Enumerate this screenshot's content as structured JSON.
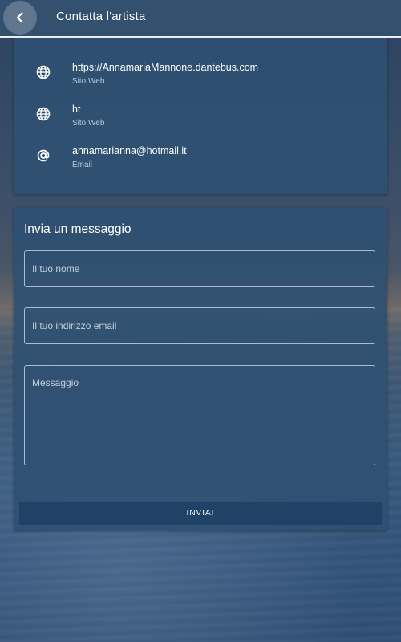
{
  "appbar": {
    "title": "Contatta l'artista",
    "back_icon": "chevron-left-icon"
  },
  "contacts": [
    {
      "icon": "globe-icon",
      "value": "https://AnnamariaMannone.dantebus.com",
      "type": "Sito Web"
    },
    {
      "icon": "globe-icon",
      "value": "ht",
      "type": "Sito Web"
    },
    {
      "icon": "at-sign-icon",
      "value": "annamarianna@hotmail.it",
      "type": "Email"
    }
  ],
  "form": {
    "title": "Invia un messaggio",
    "name_placeholder": "Il tuo nome",
    "name_value": "",
    "email_placeholder": "Il tuo indirizzo email",
    "email_value": "",
    "message_placeholder": "Messaggio",
    "message_value": "",
    "submit_label": "INVIA!"
  },
  "colors": {
    "appbar": "#34506f",
    "card": "#2f5072",
    "button": "#1f4266",
    "field_border": "#a9bbd0"
  }
}
